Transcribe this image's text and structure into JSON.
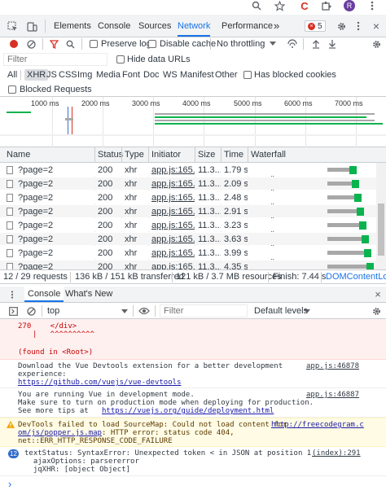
{
  "colors": {
    "tab_active": "#1a73e8",
    "record_red": "#d93025",
    "filter_red": "#d93025",
    "waterfall_green": "#0ab34e",
    "waterfall_gray": "#a8a8a8",
    "error_bg": "#fff0f0",
    "error_text": "#c80000",
    "warning_bg": "#fffbe5",
    "warning_text": "#5c3c00",
    "link": "#1a1aa6",
    "badge_blue": "#2f6bce"
  },
  "devtools": {
    "badge_count": "5",
    "tabs": [
      {
        "label": "Elements"
      },
      {
        "label": "Console"
      },
      {
        "label": "Sources"
      },
      {
        "label": "Network"
      },
      {
        "label": "Performance"
      }
    ],
    "more_tabs": "»"
  },
  "network_toolbar": {
    "preserve_log": "Preserve log",
    "disable_cache": "Disable cache",
    "throttling": "No throttling"
  },
  "filter": {
    "placeholder": "Filter",
    "hide_data_urls": "Hide data URLs",
    "types": [
      "All",
      "XHR",
      "JS",
      "CSS",
      "Img",
      "Media",
      "Font",
      "Doc",
      "WS",
      "Manifest",
      "Other"
    ],
    "active_type": "XHR",
    "has_blocked_cookies": "Has blocked cookies",
    "blocked_requests": "Blocked Requests"
  },
  "overview": {
    "ticks": [
      "1000 ms",
      "2000 ms",
      "3000 ms",
      "4000 ms",
      "5000 ms",
      "6000 ms",
      "7000 ms"
    ]
  },
  "table": {
    "columns": [
      "Name",
      "Status",
      "Type",
      "Initiator",
      "Size",
      "Time",
      "Waterfall"
    ],
    "rows": [
      {
        "name": "?page=2",
        "status": "200",
        "type": "xhr",
        "initiator": "app.js:165...",
        "size": "11.3...",
        "time": "1.79 s",
        "wf_start": 0.62,
        "wf_end": 0.85
      },
      {
        "name": "?page=2",
        "status": "200",
        "type": "xhr",
        "initiator": "app.js:165...",
        "size": "11.3...",
        "time": "2.09 s",
        "wf_start": 0.62,
        "wf_end": 0.87
      },
      {
        "name": "?page=2",
        "status": "200",
        "type": "xhr",
        "initiator": "app.js:165...",
        "size": "11.3...",
        "time": "2.48 s",
        "wf_start": 0.62,
        "wf_end": 0.89
      },
      {
        "name": "?page=2",
        "status": "200",
        "type": "xhr",
        "initiator": "app.js:165...",
        "size": "11.3...",
        "time": "2.91 s",
        "wf_start": 0.62,
        "wf_end": 0.91
      },
      {
        "name": "?page=2",
        "status": "200",
        "type": "xhr",
        "initiator": "app.js:165...",
        "size": "11.3...",
        "time": "3.23 s",
        "wf_start": 0.62,
        "wf_end": 0.93
      },
      {
        "name": "?page=2",
        "status": "200",
        "type": "xhr",
        "initiator": "app.js:165...",
        "size": "11.3...",
        "time": "3.63 s",
        "wf_start": 0.62,
        "wf_end": 0.95
      },
      {
        "name": "?page=2",
        "status": "200",
        "type": "xhr",
        "initiator": "app.js:165...",
        "size": "11.3...",
        "time": "3.99 s",
        "wf_start": 0.62,
        "wf_end": 0.97
      },
      {
        "name": "?page=2",
        "status": "200",
        "type": "xhr",
        "initiator": "app.js:165...",
        "size": "11.3...",
        "time": "4.35 s",
        "wf_start": 0.62,
        "wf_end": 0.99
      }
    ]
  },
  "status_bar": {
    "requests": "12 / 29 requests",
    "transferred": "136 kB / 151 kB transferred",
    "resources": "121 kB / 3.7 MB resources",
    "finish": "Finish: 7.44 s",
    "dom_content_loaded": "DOMContentLoad"
  },
  "drawer": {
    "tabs": [
      {
        "label": "Console"
      },
      {
        "label": "What's New"
      }
    ],
    "context": "top",
    "filter_placeholder": "Filter",
    "levels": "Default levels"
  },
  "console": {
    "error_line_number": "270",
    "error_line_code": "    </div>",
    "error_line_marker": "|   ^^^^^^^^^^",
    "error_found_in": "(found in <Root>)",
    "devtools_msg": {
      "text1": "Download the Vue Devtools extension for a better development",
      "text2": "experience:",
      "link": "https://github.com/vuejs/vue-devtools",
      "source": "app.js:46878"
    },
    "dev_mode_msg": {
      "text1": "You are running Vue in development mode.",
      "text2": "Make sure to turn on production mode when deploying for production.",
      "text3_prefix": "See more tips at ",
      "text3_link": "https://vuejs.org/guide/deployment.html",
      "source": "app.js:46887"
    },
    "warning_msg": {
      "text1_prefix": "DevTools failed to load SourceMap: Could not load content for ",
      "text1_link": "http://freecodegram.c",
      "text2_link": "om/js/popper.js.map",
      "text2_suffix": ": HTTP error: status code 404,",
      "text3": "net::ERR_HTTP_RESPONSE_CODE_FAILURE"
    },
    "grouped_msg": {
      "count": "12",
      "text1": "textStatus: SyntaxError: Unexpected token < in JSON at position 1",
      "text2": "  ajaxOptions: parsererror",
      "text3": "  jqXHR: [object Object]",
      "source": "(index):291"
    },
    "prompt": "›"
  },
  "browser": {
    "extension_label": "C",
    "profile_initial": "R"
  }
}
